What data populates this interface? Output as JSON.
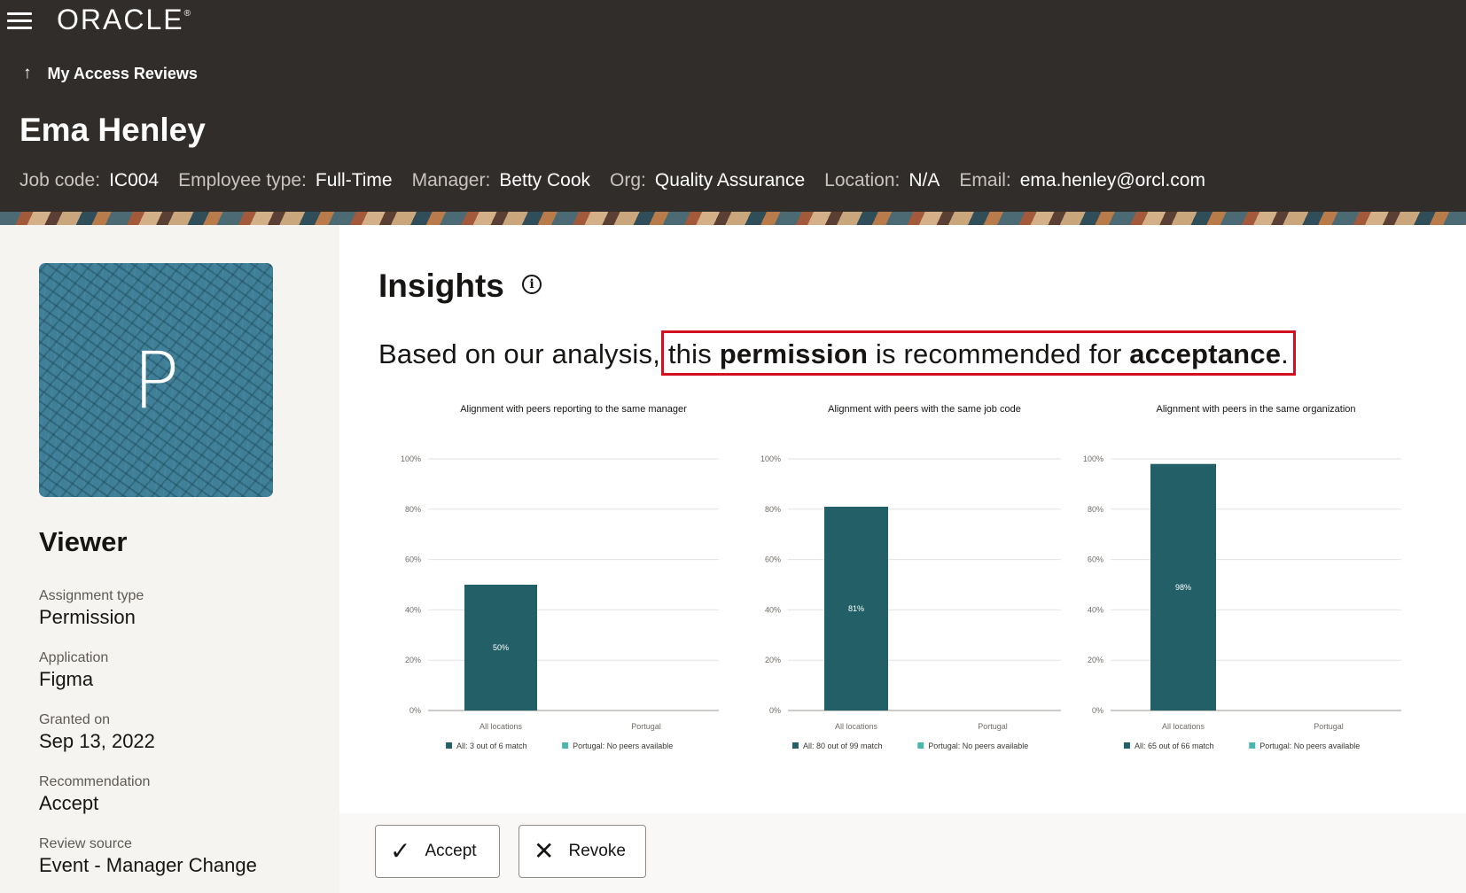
{
  "header": {
    "logo": "ORACLE",
    "back_label": "My Access Reviews"
  },
  "person": {
    "name": "Ema Henley",
    "meta": [
      {
        "label": "Job code:",
        "value": "IC004"
      },
      {
        "label": "Employee type:",
        "value": "Full-Time"
      },
      {
        "label": "Manager:",
        "value": "Betty Cook"
      },
      {
        "label": "Org:",
        "value": "Quality Assurance"
      },
      {
        "label": "Location:",
        "value": "N/A"
      },
      {
        "label": "Email:",
        "value": "ema.henley@orcl.com"
      }
    ]
  },
  "assignment": {
    "avatar_letter": "P",
    "role": "Viewer",
    "fields": [
      {
        "label": "Assignment type",
        "value": "Permission"
      },
      {
        "label": "Application",
        "value": "Figma"
      },
      {
        "label": "Granted on",
        "value": "Sep 13, 2022"
      },
      {
        "label": "Recommendation",
        "value": "Accept"
      },
      {
        "label": "Review source",
        "value": "Event - Manager Change"
      }
    ]
  },
  "insights": {
    "title": "Insights",
    "statement_prefix": "Based on our analysis, ",
    "statement_part1": "this ",
    "statement_bold1": "permission",
    "statement_part2": " is recommended for ",
    "statement_bold2": "acceptance",
    "statement_end": "."
  },
  "colors": {
    "header_bg": "#312d2a",
    "bar_all": "#235f66",
    "bar_portugal": "#4bb5b0",
    "highlight_border": "#d3101f",
    "avatar_bg": "#3f7f98"
  },
  "chart_data": [
    {
      "type": "bar",
      "title": "Alignment with peers reporting to the same manager",
      "categories": [
        "All locations",
        "Portugal"
      ],
      "series": [
        {
          "name": "All",
          "values": [
            50,
            0
          ]
        }
      ],
      "data_labels": [
        "50%",
        ""
      ],
      "yticks": [
        "0%",
        "20%",
        "40%",
        "60%",
        "80%",
        "100%"
      ],
      "ylim": [
        0,
        100
      ],
      "legend": [
        "All: 3 out of 6 match",
        "Portugal: No peers available"
      ],
      "grid": true,
      "legend_position": "bottom"
    },
    {
      "type": "bar",
      "title": "Alignment with peers with the same job code",
      "categories": [
        "All locations",
        "Portugal"
      ],
      "series": [
        {
          "name": "All",
          "values": [
            81,
            0
          ]
        }
      ],
      "data_labels": [
        "81%",
        ""
      ],
      "yticks": [
        "0%",
        "20%",
        "40%",
        "60%",
        "80%",
        "100%"
      ],
      "ylim": [
        0,
        100
      ],
      "legend": [
        "All: 80 out of 99 match",
        "Portugal: No peers available"
      ],
      "grid": true,
      "legend_position": "bottom"
    },
    {
      "type": "bar",
      "title": "Alignment with peers in the same organization",
      "categories": [
        "All locations",
        "Portugal"
      ],
      "series": [
        {
          "name": "All",
          "values": [
            98,
            0
          ]
        }
      ],
      "data_labels": [
        "98%",
        ""
      ],
      "yticks": [
        "0%",
        "20%",
        "40%",
        "60%",
        "80%",
        "100%"
      ],
      "ylim": [
        0,
        100
      ],
      "legend": [
        "All: 65 out of 66 match",
        "Portugal: No peers available"
      ],
      "grid": true,
      "legend_position": "bottom"
    }
  ],
  "actions": {
    "accept_label": "Accept",
    "revoke_label": "Revoke"
  }
}
